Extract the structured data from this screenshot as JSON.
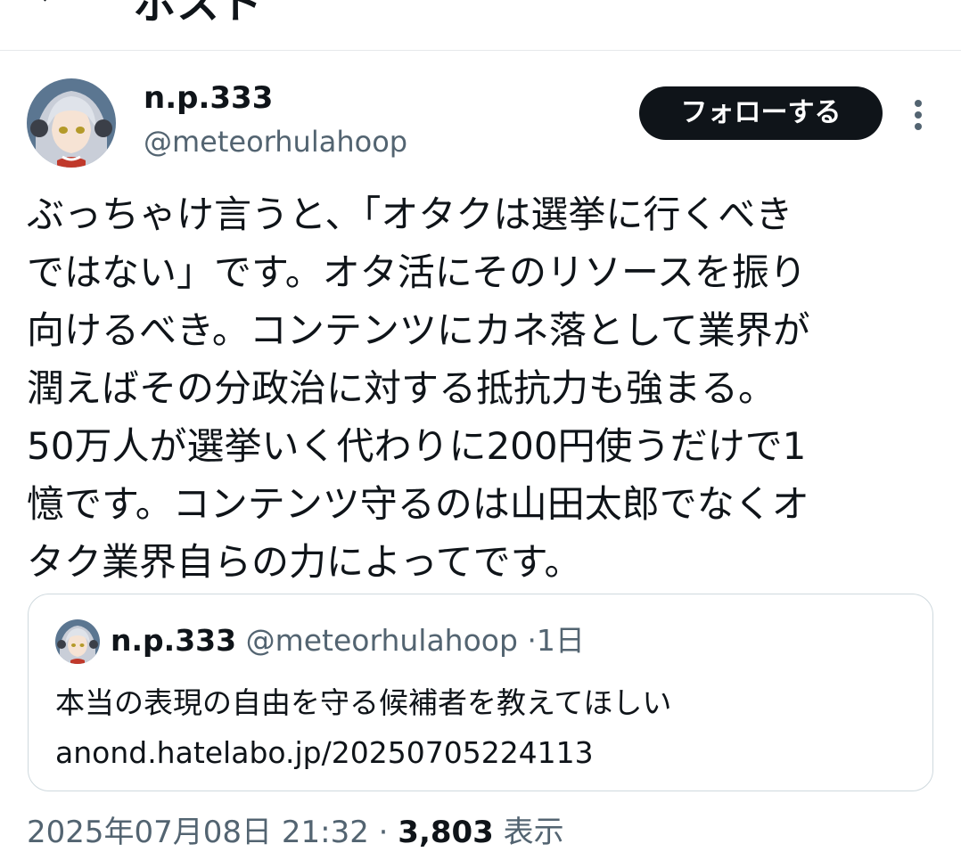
{
  "header": {
    "back_icon": "arrow-left-icon",
    "back_glyph": "←",
    "title": "ポスト"
  },
  "post": {
    "author_name": "n.p.333",
    "author_handle": "@meteorhulahoop",
    "follow_label": "フォローする",
    "more_icon": "more-vertical-icon",
    "text_lines": [
      "ぶっちゃけ言うと、「オタクは選挙に行くべき",
      "ではない」です。オタ活にそのリソースを振り",
      "向けるべき。コンテンツにカネ落として業界が",
      "潤えばその分政治に対する抵抗力も強まる。",
      "50万人が選挙いく代わりに200円使うだけで1",
      "憶です。コンテンツ守るのは山田太郎でなくオ",
      "タク業界自らの力によってです。"
    ],
    "quote": {
      "author_name": "n.p.333",
      "author_handle": "@meteorhulahoop",
      "separator": "·",
      "time": "1日",
      "text_line": "本当の表現の自由を守る候補者を教えてほしい",
      "link": "anond.hatelabo.jp/20250705224113"
    },
    "footer": {
      "timestamp": "2025年07月08日 21:32",
      "separator": "·",
      "views_count": "3,803",
      "views_label": "表示"
    }
  },
  "colors": {
    "text_primary": "#0f1419",
    "text_secondary": "#536471",
    "border": "#cfd9de",
    "follow_bg": "#0f1419",
    "follow_text": "#ffffff",
    "avatar_hair": "#c9ced8",
    "avatar_bg": "#6e8aa6"
  }
}
